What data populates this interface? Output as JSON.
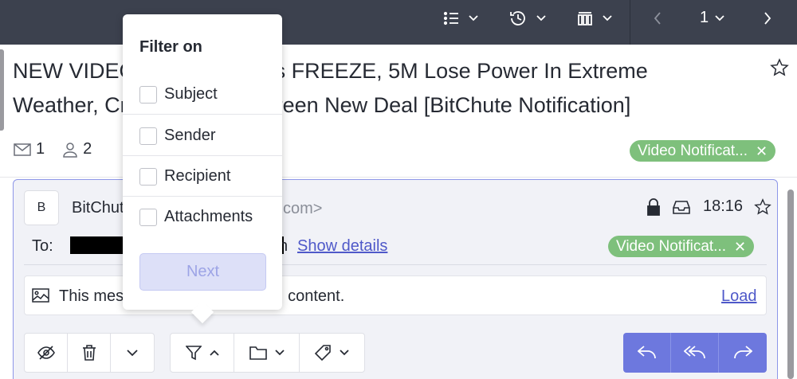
{
  "toolbar": {
    "page_number": "1"
  },
  "message": {
    "subject_line1": "NEW VIDEO: Wind Turbines FREEZE, 5M Lose Power In Extreme",
    "subject_line2": "Weather, Crushes SCAM Green New Deal [BitChute Notification]",
    "message_count": "1",
    "participant_count": "2",
    "label": "Video Notificat...",
    "label_close": "✕"
  },
  "card": {
    "avatar_letter": "B",
    "sender_name": "BitChute",
    "sender_email_suffix": "com>",
    "time": "18:16",
    "to_label": "To:",
    "to_tail": "n",
    "show_details": "Show details",
    "label": "Video Notificat...",
    "label_close": "✕",
    "notice_text_start": "This mes",
    "notice_text_end": "content.",
    "load_link": "Load"
  },
  "filter_dropdown": {
    "title": "Filter on",
    "options": [
      {
        "label": "Subject",
        "checked": false
      },
      {
        "label": "Sender",
        "checked": false
      },
      {
        "label": "Recipient",
        "checked": false
      },
      {
        "label": "Attachments",
        "checked": false
      }
    ],
    "next_button": "Next"
  },
  "colors": {
    "toolbar_bg": "#3c414e",
    "accent": "#6d78de",
    "label_green": "#7ec07c",
    "link": "#4f59c9"
  }
}
